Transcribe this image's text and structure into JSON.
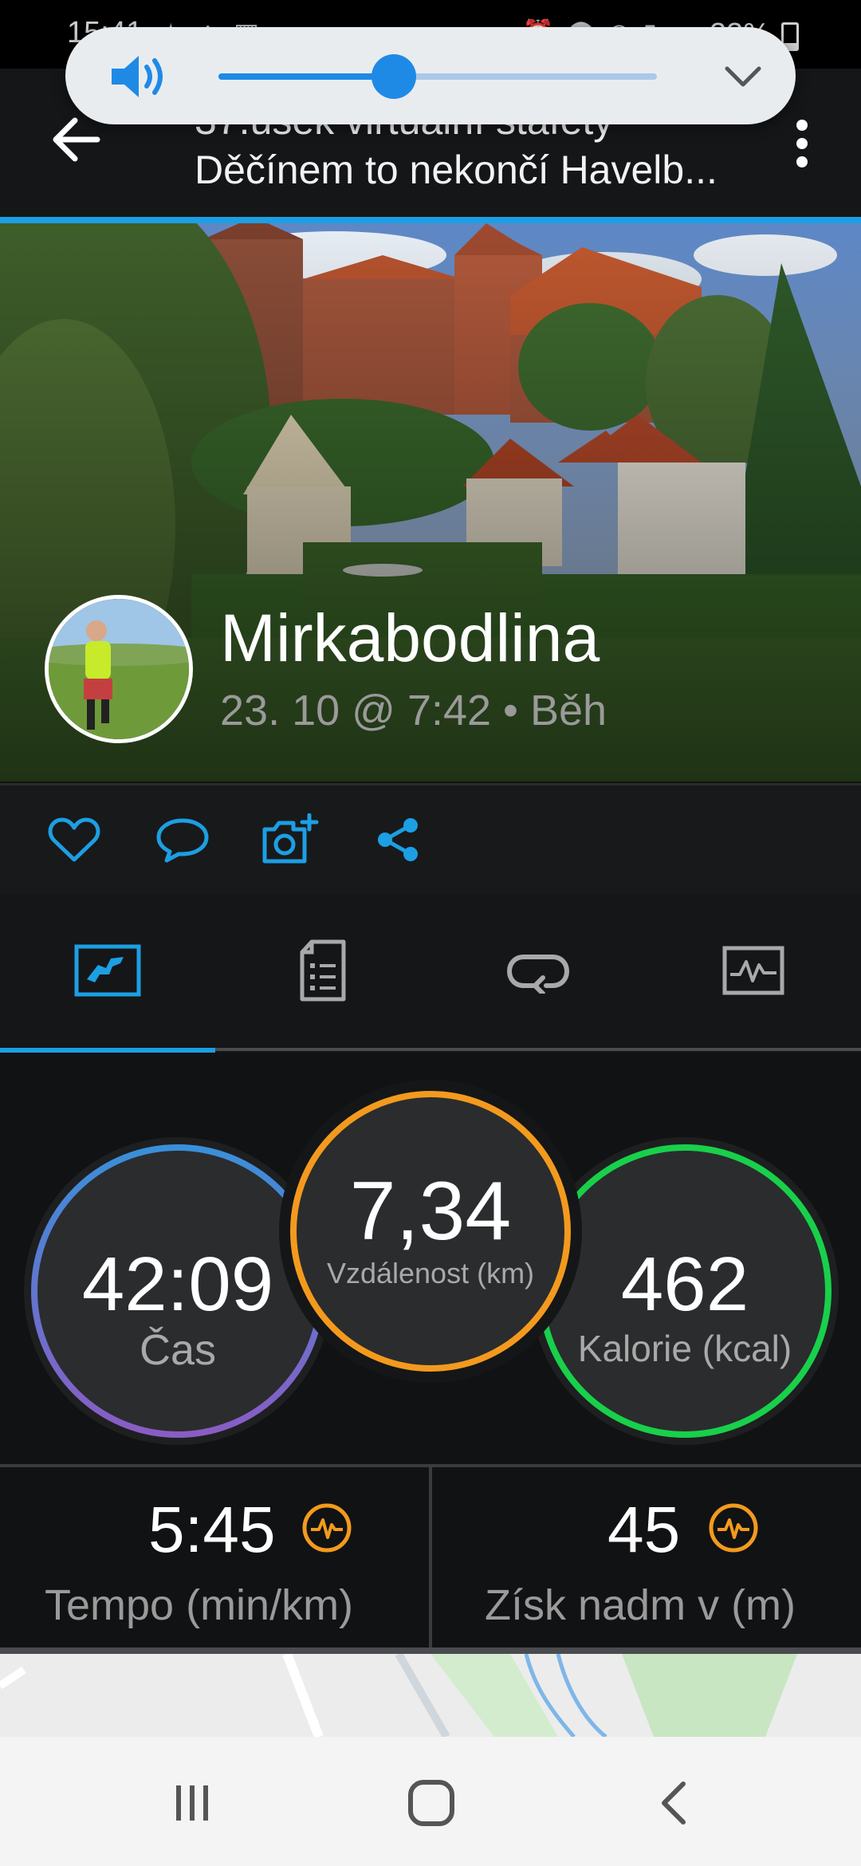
{
  "status_bar": {
    "time": "15:41",
    "battery": "23%",
    "left_icons": [
      "person-icon",
      "dots-icon",
      "clapper-icon",
      "dot-icon"
    ],
    "right_icons": [
      "alarm-icon",
      "location-icon",
      "wifi-icon",
      "lte-icon",
      "signal-icon"
    ]
  },
  "header": {
    "title_line1": "37.úsek virtuální štafety",
    "title_line2": "Děčínem to nekončí  Havelb..."
  },
  "volume": {
    "level": 0.4
  },
  "activity": {
    "user_name": "Mirkabodlina",
    "meta": "23. 10 @ 7:42 • Běh"
  },
  "actions": [
    "heart-icon",
    "comment-icon",
    "add-photo-icon",
    "share-icon"
  ],
  "tabs": [
    {
      "name": "overview",
      "selected": true
    },
    {
      "name": "details",
      "selected": false
    },
    {
      "name": "laps",
      "selected": false
    },
    {
      "name": "charts",
      "selected": false
    }
  ],
  "stats": {
    "time": {
      "value": "42:09",
      "label": "Čas"
    },
    "distance": {
      "value": "7,34",
      "label": "Vzdálenost (km)"
    },
    "calories": {
      "value": "462",
      "label": "Kalorie (kcal)"
    }
  },
  "metrics": {
    "pace": {
      "value": "5:45",
      "label": "Tempo (min/km)"
    },
    "elevation": {
      "value": "45",
      "label": "Získ nadm v (m)"
    }
  },
  "colors": {
    "accent": "#1c9fe3",
    "distance_ring": "#f39a1e",
    "calories_ring": "#18d04a",
    "time_ring_top": "#3a8fd9",
    "time_ring_bottom": "#8a5cc4",
    "metric_icon": "#f39a1e"
  }
}
